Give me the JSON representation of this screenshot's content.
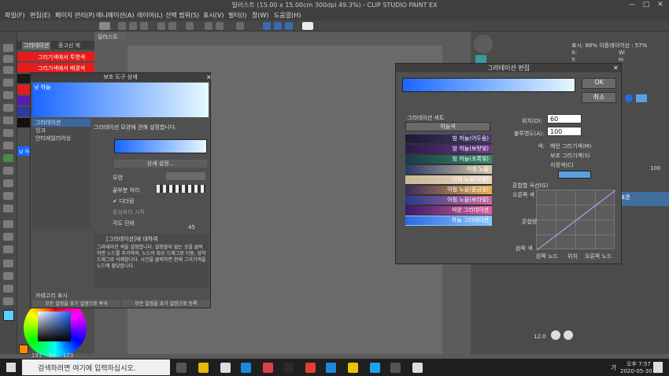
{
  "window": {
    "title": "일러스트 (15.00 x 15.00cm 300dpi 49.3%) - CLIP STUDIO PAINT EX",
    "minimize": "—",
    "maximize": "□",
    "close": "✕"
  },
  "menu": [
    "파일(F)",
    "편집(E)",
    "페이지 관리(P)",
    "애니메이션(A)",
    "레이어(L)",
    "선택 범위(S)",
    "표시(V)",
    "필터(I)",
    "창(W)",
    "도움말(H)"
  ],
  "canvas_tab": "일러스트",
  "subtool_tabs": {
    "left": "그라데이션",
    "right": "중고선 제"
  },
  "subtool_swatches": [
    "그리기색에서 투명색",
    "그리기색에서 배경색"
  ],
  "subtool_list_label": "낮 하늘",
  "sidebar_tool_label": "낮 하늘",
  "subtool_detail": {
    "title": "보조 도구 상세",
    "preset_name": "낮 하늘",
    "categories": [
      "그라데이션",
      "잉크",
      "안티에일리어싱"
    ],
    "description_header": "그라데이션 모양에 관해 설정합니다.",
    "rows": {
      "detail_button": "상세 설정...",
      "shape": "모양",
      "end_process": "끝부분 처리",
      "dithering": "디더링",
      "from_center": "중심부터 시작",
      "angle_unit": "각도 단위",
      "angle_value": "45"
    },
    "help_title": "[그라데이션]에 대하여",
    "help_body": "그라데이션 색을 설정합니다. 설정할이 없는 곳을 클릭하면 노드를 추가하며, 노드의 좌우 드래그로 이동, 상하 드래그로 삭제합니다. 시간을 클릭하면 현재 그리기색을 노드에 할당합니다.",
    "show_category": "카테고리 표시",
    "reset_all": "모든 설정을 초기 설정으로 복귀",
    "register_all": "모든 설정을 초기 설정으로 등록"
  },
  "gradient_dialog": {
    "title": "그라데이션 편집",
    "ok": "OK",
    "cancel": "취소",
    "position_label": "위치(O):",
    "position_value": "60",
    "opacity_label": "불투명도(A):",
    "opacity_value": "100",
    "set_label": "그라데이션 세트",
    "set_selected": "하늘색",
    "color_label": "색:",
    "color_options": [
      "메인 그리기색(M)",
      "보조 그리기색(S)",
      "지정색(C)"
    ],
    "mix_curve_label": "혼합할 곡선(G)",
    "graph_labels": {
      "right_color": "오른쪽 색",
      "mix_ratio": "혼합량",
      "left_color": "왼쪽 색",
      "left_node": "왼쪽 노드",
      "position": "위치",
      "right_node": "오른쪽 노드"
    },
    "gradients": [
      {
        "name": "밤 하늘(어두움)",
        "from": "#1a1a3a",
        "to": "#4a3a6a"
      },
      {
        "name": "밤 하늘(보랏빛)",
        "from": "#2a1a4a",
        "to": "#6a3a8a"
      },
      {
        "name": "밤 하늘(초록빛)",
        "from": "#1a3a4a",
        "to": "#3a8a6a"
      },
      {
        "name": "아침 노을",
        "from": "#2a3a6a",
        "to": "#d8c8a8"
      },
      {
        "name": "아침 노을(부옴)",
        "from": "#c8b89a",
        "to": "#e8d8c0"
      },
      {
        "name": "아침 노을(황금빛)",
        "from": "#3a2a5a",
        "to": "#e8b050"
      },
      {
        "name": "아침 노을(보라빛)",
        "from": "#2a3a8a",
        "to": "#c86aa0"
      },
      {
        "name": "석양 그라데이션",
        "from": "#3a1a6a",
        "to": "#e060a0"
      },
      {
        "name": "하늘 그라데이션",
        "from": "#2a6ae0",
        "to": "#8ac8ff"
      }
    ]
  },
  "right_panel": {
    "zoom_label": "표시: 88% 이중레이어선 : 57%",
    "x_label": "X:",
    "y_label": "Y:",
    "h_label": "H:",
    "w_label": "W:",
    "opacity_value": "100",
    "layer_name": "표준",
    "zoom_value": "12.0"
  },
  "palette": {
    "values": [
      "191",
      "60",
      "123"
    ]
  },
  "taskbar": {
    "search_placeholder": "검색하려면 여기에 입력하십시오.",
    "time": "오후 7:57",
    "date": "2020-05-30",
    "ampm_lang": "가"
  },
  "colors": {
    "accent_blue": "#1a66ff",
    "sky_light": "#e6f9ff",
    "red": "#e41c1c",
    "selection": "#2a6ae0"
  }
}
